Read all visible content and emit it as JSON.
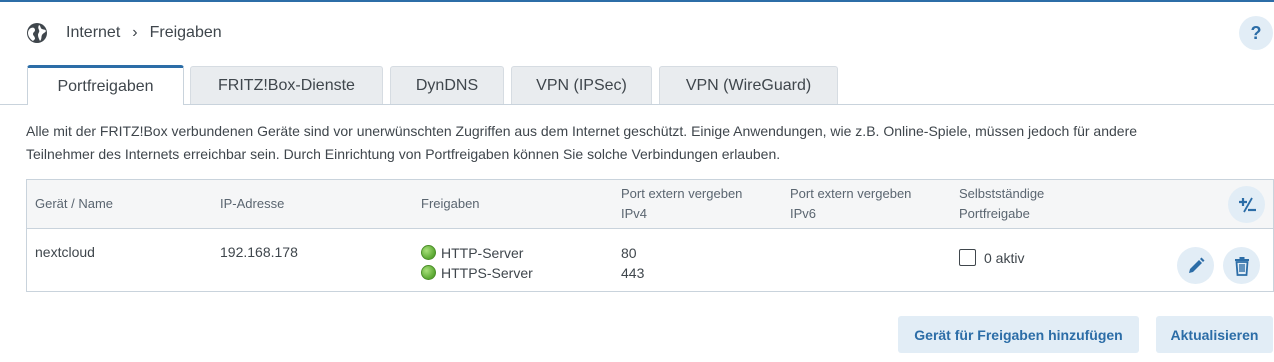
{
  "breadcrumb": {
    "icon": "globe-icon",
    "parent": "Internet",
    "separator": "›",
    "current": "Freigaben"
  },
  "help": {
    "label": "?",
    "icon": "help-icon"
  },
  "tabs": [
    {
      "label": "Portfreigaben",
      "active": true
    },
    {
      "label": "FRITZ!Box-Dienste",
      "active": false
    },
    {
      "label": "DynDNS",
      "active": false
    },
    {
      "label": "VPN (IPSec)",
      "active": false
    },
    {
      "label": "VPN (WireGuard)",
      "active": false
    }
  ],
  "intro": {
    "line1": "Alle mit der FRITZ!Box verbundenen Geräte sind vor unerwünschten Zugriffen aus dem Internet geschützt. Einige Anwendungen, wie z.B. Online-Spiele, müssen jedoch für andere",
    "line2": "Teilnehmer des Internets erreichbar sein. Durch Einrichtung von Portfreigaben können Sie solche Verbindungen erlauben."
  },
  "table": {
    "headers": {
      "device": "Gerät / Name",
      "ip": "IP-Adresse",
      "shares": "Freigaben",
      "ipv4_line1": "Port extern vergeben",
      "ipv4_line2": "IPv4",
      "ipv6_line1": "Port extern vergeben",
      "ipv6_line2": "IPv6",
      "self_line1": "Selbstständige",
      "self_line2": "Portfreigabe"
    },
    "rows": [
      {
        "device": "nextcloud",
        "ip": "192.168.178",
        "shares": [
          "HTTP-Server",
          "HTTPS-Server"
        ],
        "ports_ipv4": [
          "80",
          "443"
        ],
        "ports_ipv6": [],
        "self_checked": false,
        "self_label": "0 aktiv"
      }
    ]
  },
  "buttons": {
    "add_device": "Gerät für Freigaben hinzufügen",
    "refresh": "Aktualisieren"
  },
  "colors": {
    "accent": "#2c6da7",
    "button_bg": "#e2edf6",
    "status_green": "#5aa832"
  }
}
